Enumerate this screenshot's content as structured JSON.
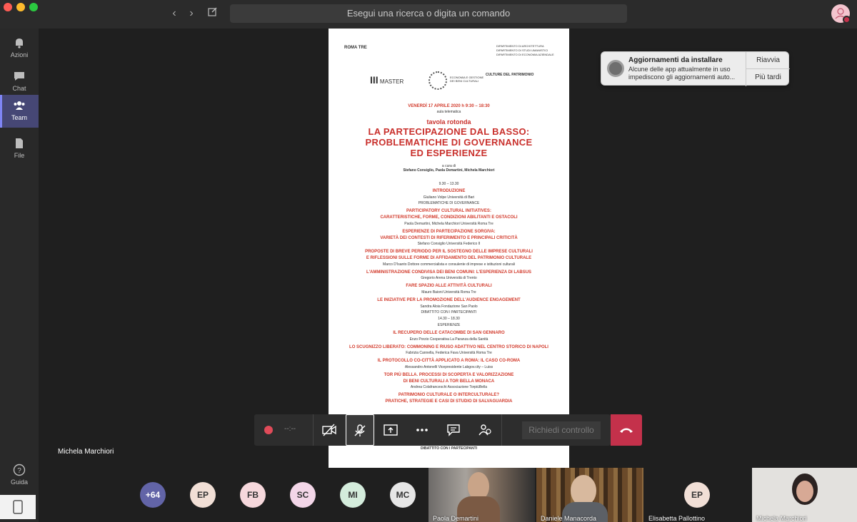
{
  "window": {
    "search_placeholder": "Esegui una ricerca o digita un comando"
  },
  "rail": {
    "items": [
      {
        "label": "Azioni",
        "icon": "bell-icon"
      },
      {
        "label": "Chat",
        "icon": "chat-icon"
      },
      {
        "label": "Team",
        "icon": "team-icon"
      },
      {
        "label": "File",
        "icon": "file-icon"
      }
    ],
    "help": "Guida"
  },
  "notification": {
    "title": "Aggiornamenti da installare",
    "body": "Alcune delle app attualmente in uso impediscono gli aggiornamenti auto...",
    "restart": "Riavvia",
    "later": "Più tardi"
  },
  "toolbar": {
    "timer": "--:--",
    "request_control": "Richiedi controllo"
  },
  "presenter_name": "Michela Marchiori",
  "participants": {
    "overflow": "+64",
    "initials": [
      "EP",
      "FB",
      "SC",
      "MI",
      "MC"
    ],
    "videos": [
      "Paola Demartini",
      "Daniele Manacorda"
    ],
    "tile": {
      "initials": "EP",
      "name": "Elisabetta Pallottino"
    },
    "self_video": "Michela Marchiori"
  },
  "doc": {
    "logo": "ROMA TRE",
    "dept": [
      "DIPARTIMENTO DI ARCHITETTURA",
      "DIPARTIMENTO DI STUDI UMANISTICI",
      "DIPARTIMENTO DI ECONOMIA AZIENDALE"
    ],
    "master": "MASTER",
    "econ": "ECONOMIA E GESTIONE DEI BENI CULTURALI",
    "culture": "CULTURE DEL PATRIMONIO",
    "date": "VENERDÌ 17 APRILE 2020   h 9:30 – 18:30",
    "place": "aula telematica",
    "kind": "tavola rotonda",
    "title": [
      "LA PARTECIPAZIONE DAL BASSO:",
      "PROBLEMATICHE DI GOVERNANCE",
      "ED ESPERIENZE"
    ],
    "curators_label": "a cura di",
    "curators": "Stefano Consiglio, Paola Demartini, Michela Marchiori",
    "time1": "9.30 – 13.30",
    "lines": [
      [
        "r",
        "INTRODUZIONE"
      ],
      [
        "k",
        "Giuliano Volpe  Università di Bari"
      ],
      [
        "k",
        "PROBLEMATICHE DI GOVERNANCE"
      ],
      [
        "r",
        "PARTICIPATORY CULTURAL INITIATIVES:"
      ],
      [
        "r",
        "CARATTERISTICHE, FORME, CONDIZIONI ABILITANTI E OSTACOLI"
      ],
      [
        "k",
        "Paola Demartini, Michela Marchiori  Università Roma Tre"
      ],
      [
        "r",
        "ESPERIENZE DI PARTECIPAZIONE SORGIVA:"
      ],
      [
        "r",
        "VARIETÀ DEI CONTESTI DI RIFERIMENTO E PRINCIPALI CRITICITÀ"
      ],
      [
        "k",
        "Stefano Consiglio  Università Federico II"
      ],
      [
        "r",
        "PROPOSTE DI BREVE PERIODO PER IL SOSTEGNO DELLE IMPRESE CULTURALI"
      ],
      [
        "r",
        "E RIFLESSIONI SULLE FORME DI AFFIDAMENTO DEL PATRIMONIO CULTURALE"
      ],
      [
        "k",
        "Marco D'Isanto  Dottore commercialista e consulente di imprese e istituzioni culturali"
      ],
      [
        "r",
        "L'AMMINISTRAZIONE CONDIVISA DEI BENI COMUNI: L'ESPERIENZA DI LABSUS"
      ],
      [
        "k",
        "Gregorio Arena  Università di Trento"
      ],
      [
        "r",
        "FARE SPAZIO ALLE ATTIVITÀ CULTURALI"
      ],
      [
        "k",
        "Mauro Baioni  Università Roma Tre"
      ],
      [
        "r",
        "LE INIZIATIVE PER LA PROMOZIONE DELL'AUDIENCE ENGAGEMENT"
      ],
      [
        "k",
        "Sandra Aloia  Fondazione San Paolo"
      ],
      [
        "k",
        "DIBATTITO CON I PARTECIPANTI"
      ],
      [
        "k",
        "14.30 – 18.30"
      ],
      [
        "k",
        "ESPERIENZE"
      ],
      [
        "r",
        "IL RECUPERO DELLE CATACOMBE DI SAN GENNARO"
      ],
      [
        "k",
        "Enzo Porzio  Cooperativa La Paranza della Sanità"
      ],
      [
        "r",
        "LO SCUGNIZZO LIBERATO: COMMONING E RIUSO ADATTIVO NEL CENTRO STORICO DI NAPOLI"
      ],
      [
        "k",
        "Fabrizia Cannella, Federica Fava  Università Roma Tre"
      ],
      [
        "r",
        "IL PROTOCOLLO CO-CITTÀ APPLICATO A ROMA: IL CASO CO-ROMA"
      ],
      [
        "k",
        "Alessandro Antonelli  Vicepresidente Labgov.city – Luiss"
      ],
      [
        "r",
        "TOR PIÙ BELLA. PROCESSI DI SCOPERTA E VALORIZZAZIONE"
      ],
      [
        "r",
        "DI BENI CULTURALI A TOR BELLA MONACA"
      ],
      [
        "k",
        "Andrea Colafranceschi  Associazione TorpiùBella"
      ],
      [
        "r",
        "PATRIMONIO CULTURALE O INTERCULTURALE?"
      ],
      [
        "r",
        "PRATICHE, STRATEGIE E CASI DI STUDIO DI SALVAGUARDIA"
      ]
    ],
    "footer": "DIBATTITO CON I PARTECIPANTI"
  }
}
